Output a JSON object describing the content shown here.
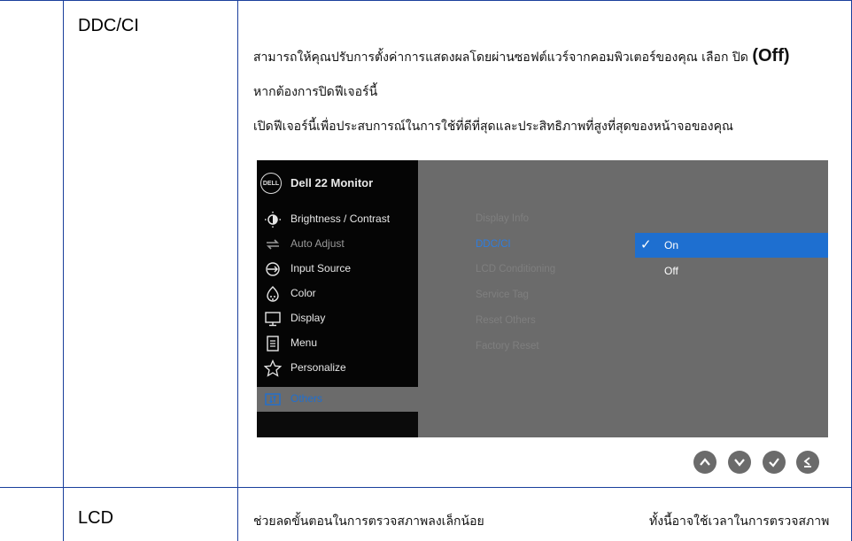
{
  "rows": {
    "ddcci": {
      "label": "DDC/CI",
      "desc_line1": "สามารถให้คุณปรับการตั้งค่าการแสดงผลโดยผ่านซอฟต์แวร์จากคอมพิวเตอร์ของคุณ  เลือก ปิด ",
      "desc_line1_off": "(Off)",
      "desc_line2": "หากต้องการปิดฟีเจอร์นี้",
      "desc_line3": "เปิดฟีเจอร์นี้เพื่อประสบการณ์ในการใช้ที่ดีที่สุดและประสิทธิภาพที่สูงที่สุดของหน้าจอของคุณ"
    },
    "lcd": {
      "label": "LCD",
      "desc_left": "ช่วยลดขั้นตอนในการตรวจสภาพลงเล็กน้อย",
      "desc_right": "ทั้งนี้อาจใช้เวลาในการตรวจสภาพ"
    }
  },
  "osd": {
    "logo": "DELL",
    "title": "Dell 22 Monitor",
    "menu": [
      {
        "label": "Brightness / Contrast",
        "icon": "brightness-icon"
      },
      {
        "label": "Auto Adjust",
        "icon": "auto-adjust-icon"
      },
      {
        "label": "Input Source",
        "icon": "input-source-icon"
      },
      {
        "label": "Color",
        "icon": "color-icon"
      },
      {
        "label": "Display",
        "icon": "display-icon"
      },
      {
        "label": "Menu",
        "icon": "menu-icon"
      },
      {
        "label": "Personalize",
        "icon": "star-icon"
      },
      {
        "label": "Others",
        "icon": "others-icon"
      }
    ],
    "submenu": [
      "Display Info",
      "DDC/CI",
      "LCD Conditioning",
      "Service Tag",
      "Reset Others",
      "Factory Reset"
    ],
    "options": [
      "On",
      "Off"
    ],
    "colors": {
      "highlight": "#1e6fd0",
      "panel": "#6b6b6b",
      "sidebar": "#050505"
    }
  },
  "nav_buttons": [
    "up-icon",
    "down-icon",
    "check-icon",
    "back-icon"
  ]
}
